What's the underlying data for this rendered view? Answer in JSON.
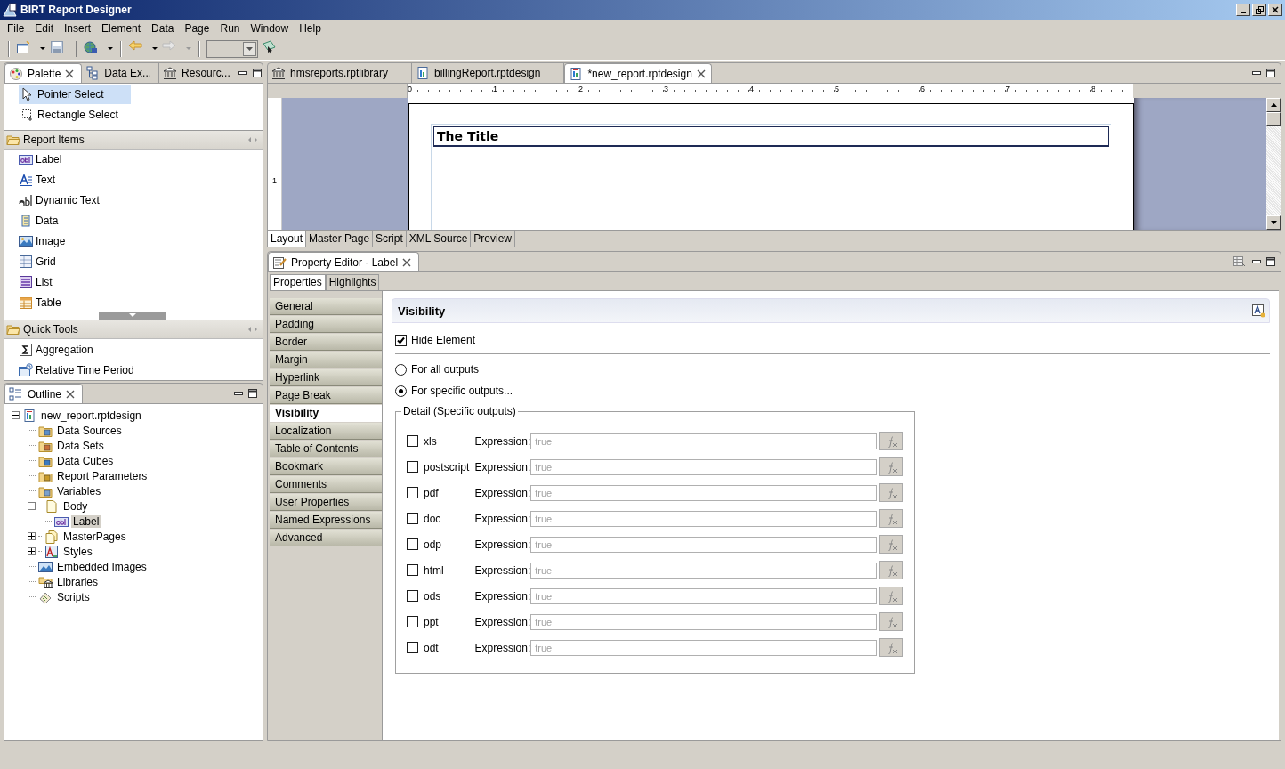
{
  "window": {
    "title": "BIRT Report Designer"
  },
  "menu": [
    "File",
    "Edit",
    "Insert",
    "Element",
    "Data",
    "Page",
    "Run",
    "Window",
    "Help"
  ],
  "palette_view": {
    "tabs": [
      {
        "label": "Palette",
        "selected": true
      },
      {
        "label": "Data Ex...",
        "selected": false
      },
      {
        "label": "Resourc...",
        "selected": false
      }
    ],
    "tools": [
      {
        "label": "Pointer Select",
        "selected": true
      },
      {
        "label": "Rectangle Select",
        "selected": false
      }
    ],
    "drawers": [
      {
        "title": "Report Items",
        "items": [
          "Label",
          "Text",
          "Dynamic Text",
          "Data",
          "Image",
          "Grid",
          "List",
          "Table"
        ]
      },
      {
        "title": "Quick Tools",
        "items": [
          "Aggregation",
          "Relative Time Period"
        ]
      }
    ]
  },
  "outline": {
    "title": "Outline",
    "tree": [
      {
        "label": "new_report.rptdesign",
        "expanded": true,
        "selected": false,
        "children": [
          {
            "label": "Data Sources",
            "selected": false
          },
          {
            "label": "Data Sets",
            "selected": false
          },
          {
            "label": "Data Cubes",
            "selected": false
          },
          {
            "label": "Report Parameters",
            "selected": false
          },
          {
            "label": "Variables",
            "selected": false
          },
          {
            "label": "Body",
            "expanded": true,
            "selected": false,
            "children": [
              {
                "label": "Label",
                "selected": true
              }
            ]
          },
          {
            "label": "MasterPages",
            "expanded": false,
            "selected": false
          },
          {
            "label": "Styles",
            "expanded": false,
            "selected": false
          },
          {
            "label": "Embedded Images",
            "selected": false
          },
          {
            "label": "Libraries",
            "selected": false
          },
          {
            "label": "Scripts",
            "selected": false
          }
        ]
      }
    ]
  },
  "editor": {
    "tabs": [
      {
        "label": "hmsreports.rptlibrary",
        "selected": false
      },
      {
        "label": "billingReport.rptdesign",
        "selected": false
      },
      {
        "label": "*new_report.rptdesign",
        "selected": true
      }
    ],
    "ruler_labels": [
      "0",
      "1",
      "2",
      "3",
      "4",
      "5",
      "6",
      "7",
      "8"
    ],
    "vertical_ruler_labels": [
      "1"
    ],
    "title_label": "The Title",
    "bottom_tabs": [
      {
        "label": "Layout",
        "selected": true
      },
      {
        "label": "Master Page",
        "selected": false
      },
      {
        "label": "Script",
        "selected": false
      },
      {
        "label": "XML Source",
        "selected": false
      },
      {
        "label": "Preview",
        "selected": false
      }
    ]
  },
  "property_editor": {
    "title": "Property Editor - Label",
    "tabs": [
      {
        "label": "Properties",
        "selected": true
      },
      {
        "label": "Highlights",
        "selected": false
      }
    ],
    "categories": [
      {
        "label": "General",
        "selected": false
      },
      {
        "label": "Padding",
        "selected": false
      },
      {
        "label": "Border",
        "selected": false
      },
      {
        "label": "Margin",
        "selected": false
      },
      {
        "label": "Hyperlink",
        "selected": false
      },
      {
        "label": "Page Break",
        "selected": false
      },
      {
        "label": "Visibility",
        "selected": true
      },
      {
        "label": "Localization",
        "selected": false
      },
      {
        "label": "Table of Contents",
        "selected": false
      },
      {
        "label": "Bookmark",
        "selected": false
      },
      {
        "label": "Comments",
        "selected": false
      },
      {
        "label": "User Properties",
        "selected": false
      },
      {
        "label": "Named Expressions",
        "selected": false
      },
      {
        "label": "Advanced",
        "selected": false
      }
    ],
    "section_title": "Visibility",
    "hide_element": {
      "label": "Hide Element",
      "checked": true
    },
    "radios": [
      {
        "label": "For all outputs",
        "selected": false
      },
      {
        "label": "For specific outputs...",
        "selected": true
      }
    ],
    "group_title": "Detail (Specific outputs)",
    "outputs": [
      {
        "name": "xls",
        "checked": false,
        "expression_label": "Expression:",
        "value": "true",
        "disabled": true
      },
      {
        "name": "postscript",
        "checked": false,
        "expression_label": "Expression:",
        "value": "true",
        "disabled": true
      },
      {
        "name": "pdf",
        "checked": false,
        "expression_label": "Expression:",
        "value": "true",
        "disabled": true
      },
      {
        "name": "doc",
        "checked": false,
        "expression_label": "Expression:",
        "value": "true",
        "disabled": true
      },
      {
        "name": "odp",
        "checked": false,
        "expression_label": "Expression:",
        "value": "true",
        "disabled": true
      },
      {
        "name": "html",
        "checked": false,
        "expression_label": "Expression:",
        "value": "true",
        "disabled": true
      },
      {
        "name": "ods",
        "checked": false,
        "expression_label": "Expression:",
        "value": "true",
        "disabled": true
      },
      {
        "name": "ppt",
        "checked": false,
        "expression_label": "Expression:",
        "value": "true",
        "disabled": true
      },
      {
        "name": "odt",
        "checked": false,
        "expression_label": "Expression:",
        "value": "true",
        "disabled": true
      }
    ]
  }
}
